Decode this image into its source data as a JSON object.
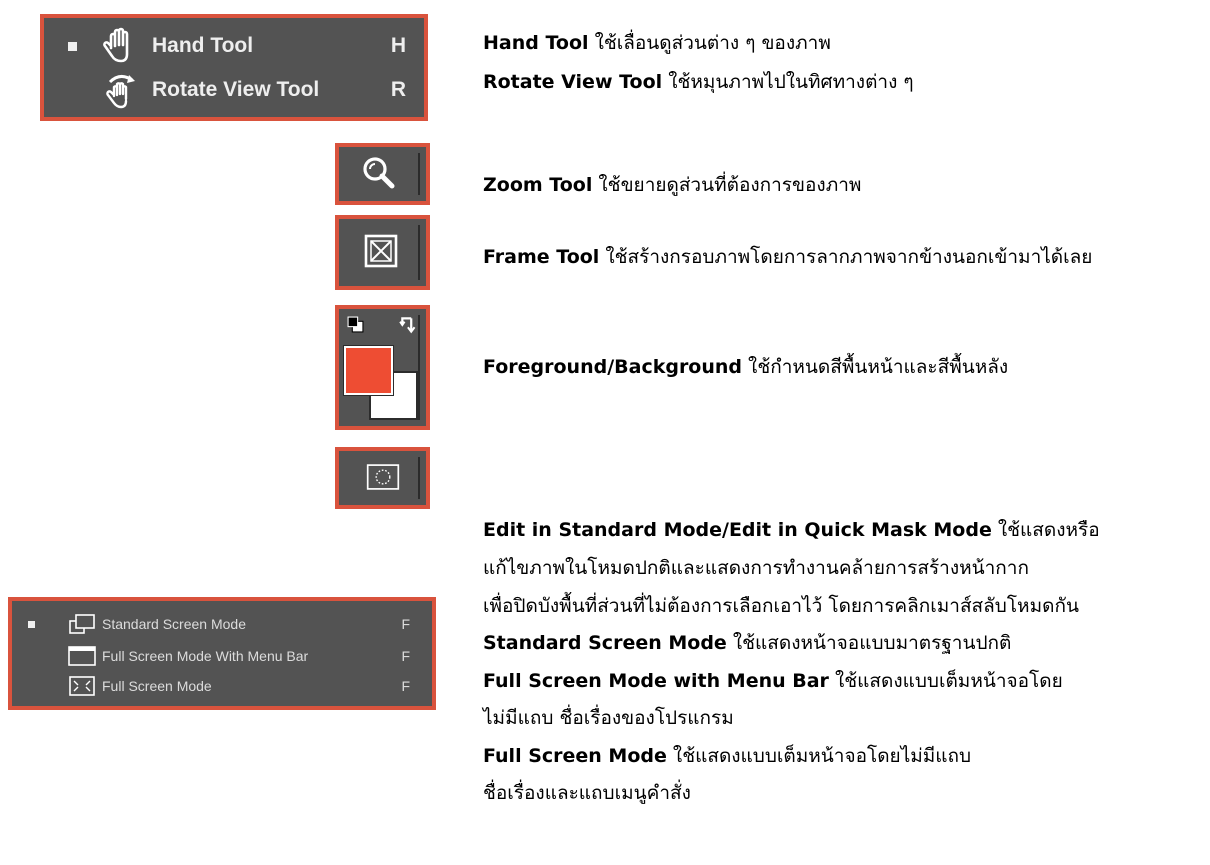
{
  "hand_panel": {
    "items": [
      {
        "label": "Hand Tool",
        "key": "H",
        "selected": true
      },
      {
        "label": "Rotate View Tool",
        "key": "R",
        "selected": false
      }
    ]
  },
  "screen_panel": {
    "items": [
      {
        "label": "Standard Screen Mode",
        "key": "F",
        "selected": true
      },
      {
        "label": "Full Screen Mode With Menu Bar",
        "key": "F",
        "selected": false
      },
      {
        "label": "Full Screen Mode",
        "key": "F",
        "selected": false
      }
    ]
  },
  "colors": {
    "panel_bg": "#535353",
    "border": "#d9533d",
    "foreground_swatch": "#ee4d33",
    "background_swatch": "#ffffff"
  },
  "descriptions": {
    "hand": {
      "name": "Hand Tool",
      "text": " ใช้เลื่อนดูส่วนต่าง ๆ ของภาพ"
    },
    "rotate": {
      "name": "Rotate View Tool",
      "text": " ใช้หมุนภาพไปในทิศทางต่าง ๆ"
    },
    "zoom": {
      "name": "Zoom Tool",
      "text": " ใช้ขยายดูส่วนที่ต้องการของภาพ"
    },
    "frame": {
      "name": "Frame Tool",
      "text": " ใช้สร้างกรอบภาพโดยการลากภาพจากข้างนอกเข้ามาได้เลย"
    },
    "fgbg": {
      "name": "Foreground/Background",
      "text": " ใช้กำหนดสีพื้นหน้าและสีพื้นหลัง"
    },
    "mask": {
      "name": "Edit in Standard Mode/Edit in Quick Mask Mode",
      "text": " ใช้แสดงหรือ",
      "line2": "แก้ไขภาพในโหมดปกติและแสดงการทำงานคล้ายการสร้างหน้ากาก",
      "line3": "เพื่อปิดบังพื้นที่ส่วนที่ไม่ต้องการเลือกเอาไว้ โดยการคลิกเมาส์สลับโหมดกัน"
    },
    "standard": {
      "name": "Standard Screen Mode",
      "text": " ใช้แสดงหน้าจอแบบมาตรฐานปกติ"
    },
    "fullmenu": {
      "name": "Full Screen Mode with Menu Bar",
      "text": " ใช้แสดงแบบเต็มหน้าจอโดย",
      "line2": "ไม่มีแถบ  ชื่อเรื่องของโปรแกรม"
    },
    "full": {
      "name": "Full Screen Mode",
      "text": "  ใช้แสดงแบบเต็มหน้าจอโดยไม่มีแถบ",
      "line2": "ชื่อเรื่องและแถบเมนูคำสั่ง"
    }
  }
}
